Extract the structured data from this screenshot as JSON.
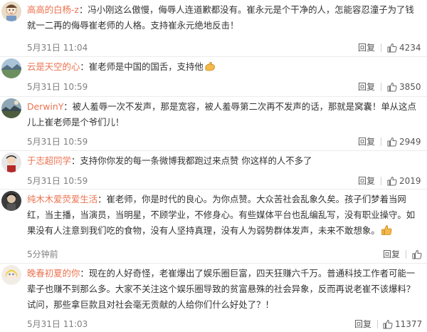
{
  "comments": [
    {
      "user": "高高的白杨-z",
      "sep": "：",
      "text": "冯小刚这么傲慢，侮辱人连道歉都没有。崔永元是个干净的人，怎能容忍潼子为了钱就一二再的侮辱崔老师的人格。支持崔永元绝地反击！",
      "time": "5月31日 11:04",
      "reply_label": "回复",
      "likes": "4234",
      "emoji": ""
    },
    {
      "user": "云是天空的心",
      "sep": "：",
      "text": "崔老师是中国的国舌，支持他",
      "time": "5月31日 10:59",
      "reply_label": "回复",
      "likes": "3850",
      "emoji": "strong-arm"
    },
    {
      "user": "DerwinY",
      "sep": "：",
      "text": "被人羞辱一次不发声，那是宽容，被人羞辱第二次再不发声的话，那就是窝囊！单从这点儿上崔老师是个爷们儿！",
      "time": "5月31日 10:59",
      "reply_label": "回复",
      "likes": "2949",
      "emoji": ""
    },
    {
      "user": "于志超同学",
      "sep": "：",
      "text": "支持你你发的每一条微博我都跑过来点赞 你这样的人不多了",
      "time": "5月31日 10:59",
      "reply_label": "回复",
      "likes": "2019",
      "emoji": ""
    },
    {
      "user": "纯木木爱荧爱生活",
      "sep": "：",
      "text": "崔老师，你是时代的良心。为你点赞。大众苦社会乱象久矣。孩子们梦着当网红，当主播，当演员，当明星，不顾学业，不修身心。有些媒体平台也乱编乱写，没有职业操守。如果没有人注意到我们吃的食物，没有人坚持真理，没有人为弱势群体发声，未来不敢想象。",
      "time": "5分钟前",
      "reply_label": "回复",
      "likes": "",
      "emoji": "thumbs-up"
    },
    {
      "user": "晚春初夏的你",
      "sep": "：",
      "text": "现在的人好奇怪，老崔爆出了娱乐圈巨富，四天狂赚六千万。普通科技工作者可能一辈子也赚不到那么多。大家不关注这个娱乐圈导致的贫富悬殊的社会异象，反而再说老崔不该爆料？试问，那些拿巨款且对社会毫无贡献的人给你们什么好处了？！",
      "time": "5月31日 11:03",
      "reply_label": "回复",
      "likes": "11377",
      "emoji": ""
    }
  ],
  "colors": {
    "username": "#eb7350",
    "text": "#333333",
    "meta": "#808080",
    "divider": "#ececec"
  }
}
